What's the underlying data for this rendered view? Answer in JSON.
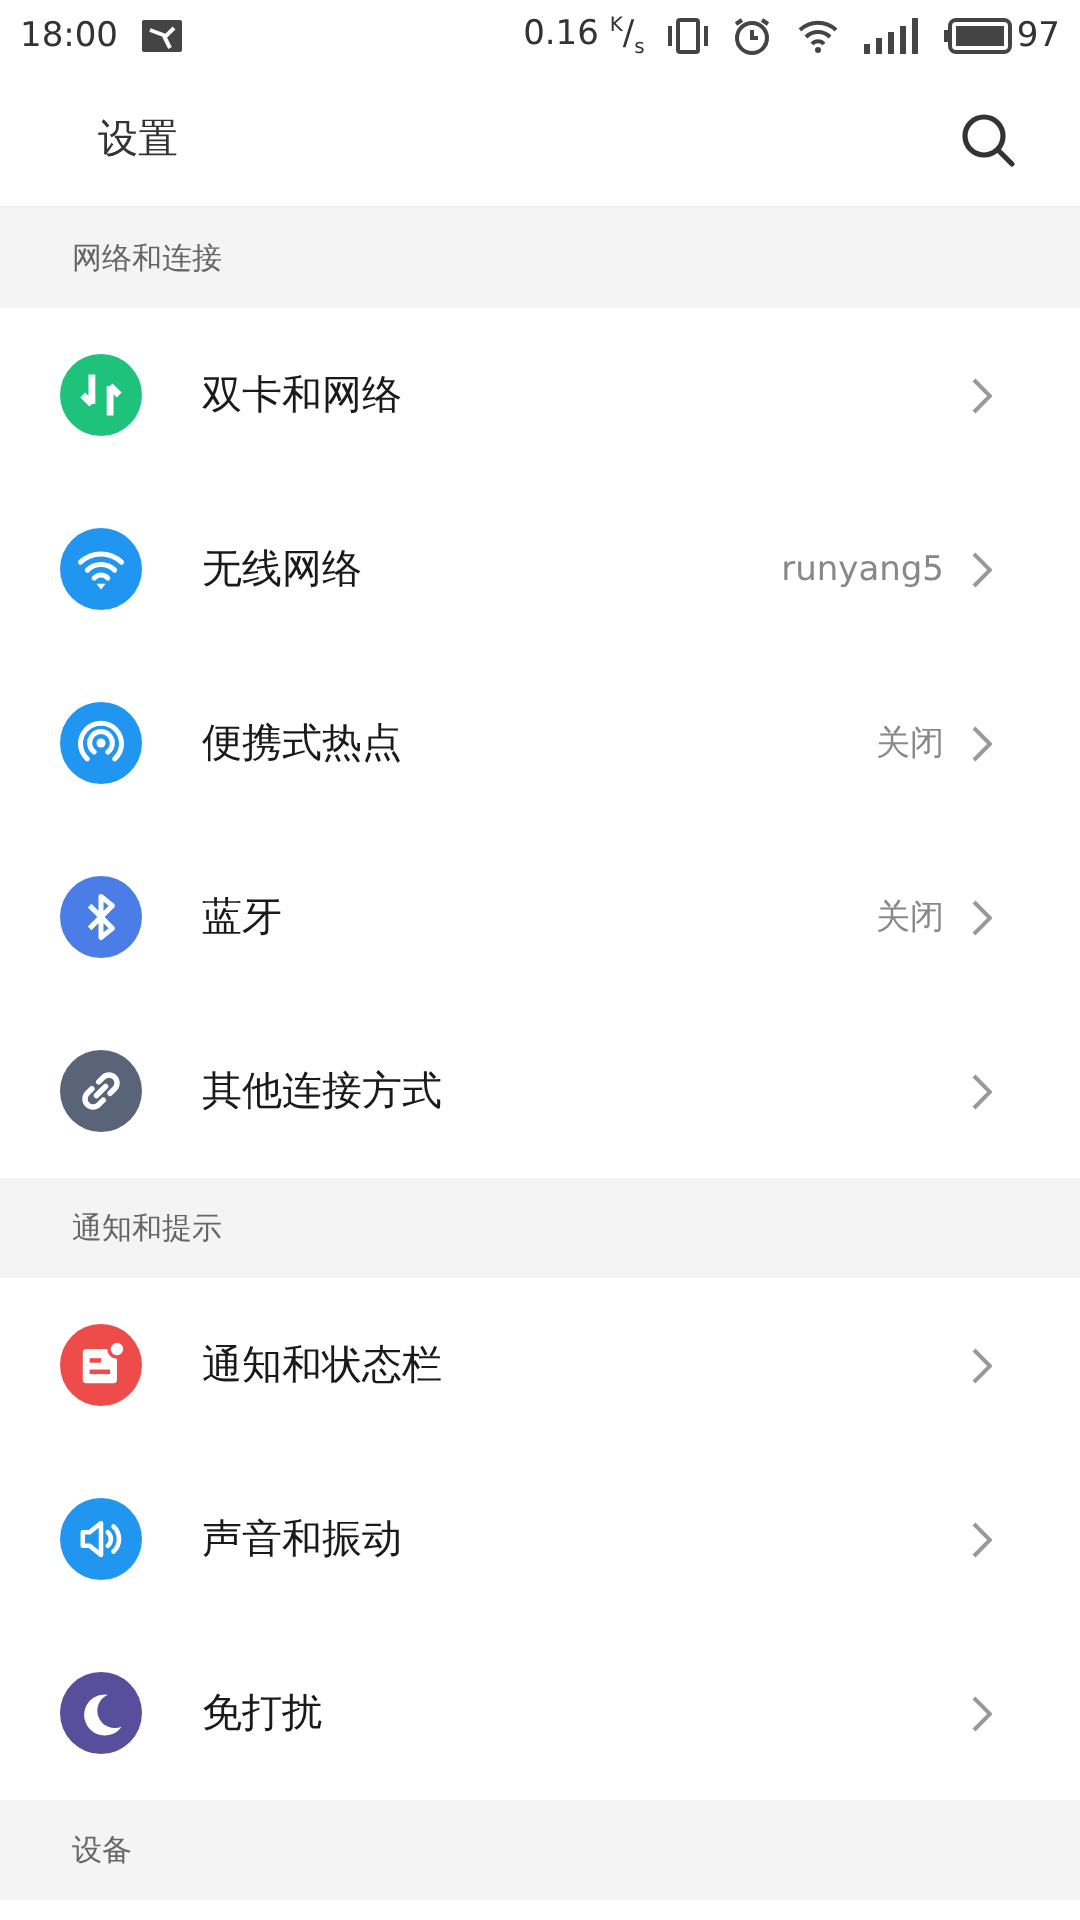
{
  "status_bar": {
    "time": "18:00",
    "speed": "0.16 $^{K}$/$_{s}$",
    "battery": "97"
  },
  "header": {
    "title": "设置"
  },
  "sections": [
    {
      "title": "网络和连接",
      "items": [
        {
          "label": "双卡和网络",
          "kind": "swap",
          "color": "#1fc27a"
        },
        {
          "label": "无线网络",
          "value": "runyang5",
          "kind": "wifi",
          "color": "#2196f0"
        },
        {
          "label": "便携式热点",
          "value": "关闭",
          "kind": "hotspot",
          "color": "#2196f0"
        },
        {
          "label": "蓝牙",
          "value": "关闭",
          "kind": "bluetooth",
          "color": "#4a7de6"
        },
        {
          "label": "其他连接方式",
          "kind": "link",
          "color": "#5a6478"
        }
      ]
    },
    {
      "title": "通知和提示",
      "items": [
        {
          "label": "通知和状态栏",
          "kind": "notification",
          "color": "#ee4b4b"
        },
        {
          "label": "声音和振动",
          "kind": "sound",
          "color": "#2196f0"
        },
        {
          "label": "免打扰",
          "kind": "moon",
          "color": "#574e9c"
        }
      ]
    },
    {
      "title": "设备"
    }
  ]
}
